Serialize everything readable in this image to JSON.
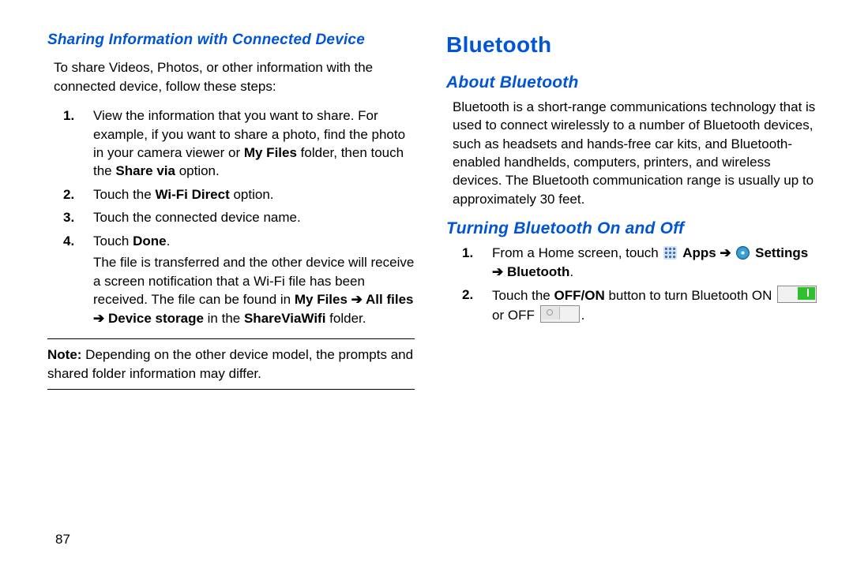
{
  "page_number": "87",
  "left": {
    "heading": "Sharing Information with Connected Device",
    "intro": "To share Videos, Photos, or other information with the connected device, follow these steps:",
    "steps": [
      {
        "n": "1.",
        "pre": "View the information that you want to share. For example, if you want to share a photo, find the photo in your camera viewer or ",
        "b1": "My Files",
        "mid1": " folder, then touch the ",
        "b2": "Share via",
        "post": " option."
      },
      {
        "n": "2.",
        "pre": "Touch the ",
        "b1": "Wi-Fi Direct",
        "post": " option."
      },
      {
        "n": "3.",
        "text": "Touch the connected device name."
      },
      {
        "n": "4.",
        "pre": "Touch ",
        "b1": "Done",
        "post": ".",
        "para2_pre": "The file is transferred and the other device will receive a screen notification that a Wi-Fi file has been received. The file can be found in ",
        "para2_b1": "My Files",
        "para2_arrow1": " ➔ ",
        "para2_b2": "All files",
        "para2_arrow2": " ➔ ",
        "para2_b3": "Device storage",
        "para2_mid": " in the ",
        "para2_b4": "ShareViaWifi",
        "para2_post": " folder."
      }
    ],
    "note_label": "Note:",
    "note_text": " Depending on the other device model, the prompts and shared folder information may differ."
  },
  "right": {
    "heading": "Bluetooth",
    "sub1": "About Bluetooth",
    "about": "Bluetooth is a short-range communications technology that is used to connect wirelessly to a number of Bluetooth devices, such as headsets and hands-free car kits, and Bluetooth-enabled handhelds, computers, printers, and wireless devices. The Bluetooth communication range is usually up to approximately 30 feet.",
    "sub2": "Turning Bluetooth On and Off",
    "step1": {
      "n": "1.",
      "pre": "From a Home screen, touch ",
      "apps": "Apps",
      "arrow1": " ➔ ",
      "settings": "Settings",
      "arrow2": " ➔ ",
      "bt": "Bluetooth",
      "post": "."
    },
    "step2": {
      "n": "2.",
      "pre": "Touch the ",
      "b1": "OFF/ON",
      "mid": " button to turn Bluetooth ON ",
      "mid2": " or OFF ",
      "post": "."
    }
  }
}
